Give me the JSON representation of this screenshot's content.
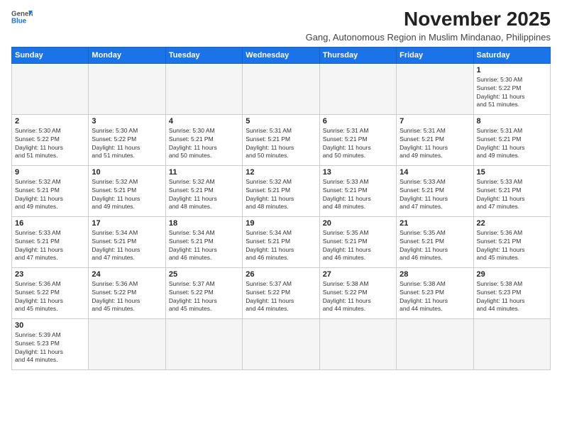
{
  "header": {
    "logo_general": "General",
    "logo_blue": "Blue",
    "month_title": "November 2025",
    "subtitle": "Gang, Autonomous Region in Muslim Mindanao, Philippines"
  },
  "weekdays": [
    "Sunday",
    "Monday",
    "Tuesday",
    "Wednesday",
    "Thursday",
    "Friday",
    "Saturday"
  ],
  "weeks": [
    [
      {
        "day": "",
        "info": ""
      },
      {
        "day": "",
        "info": ""
      },
      {
        "day": "",
        "info": ""
      },
      {
        "day": "",
        "info": ""
      },
      {
        "day": "",
        "info": ""
      },
      {
        "day": "",
        "info": ""
      },
      {
        "day": "1",
        "info": "Sunrise: 5:30 AM\nSunset: 5:22 PM\nDaylight: 11 hours\nand 51 minutes."
      }
    ],
    [
      {
        "day": "2",
        "info": "Sunrise: 5:30 AM\nSunset: 5:22 PM\nDaylight: 11 hours\nand 51 minutes."
      },
      {
        "day": "3",
        "info": "Sunrise: 5:30 AM\nSunset: 5:22 PM\nDaylight: 11 hours\nand 51 minutes."
      },
      {
        "day": "4",
        "info": "Sunrise: 5:30 AM\nSunset: 5:21 PM\nDaylight: 11 hours\nand 50 minutes."
      },
      {
        "day": "5",
        "info": "Sunrise: 5:31 AM\nSunset: 5:21 PM\nDaylight: 11 hours\nand 50 minutes."
      },
      {
        "day": "6",
        "info": "Sunrise: 5:31 AM\nSunset: 5:21 PM\nDaylight: 11 hours\nand 50 minutes."
      },
      {
        "day": "7",
        "info": "Sunrise: 5:31 AM\nSunset: 5:21 PM\nDaylight: 11 hours\nand 49 minutes."
      },
      {
        "day": "8",
        "info": "Sunrise: 5:31 AM\nSunset: 5:21 PM\nDaylight: 11 hours\nand 49 minutes."
      }
    ],
    [
      {
        "day": "9",
        "info": "Sunrise: 5:32 AM\nSunset: 5:21 PM\nDaylight: 11 hours\nand 49 minutes."
      },
      {
        "day": "10",
        "info": "Sunrise: 5:32 AM\nSunset: 5:21 PM\nDaylight: 11 hours\nand 49 minutes."
      },
      {
        "day": "11",
        "info": "Sunrise: 5:32 AM\nSunset: 5:21 PM\nDaylight: 11 hours\nand 48 minutes."
      },
      {
        "day": "12",
        "info": "Sunrise: 5:32 AM\nSunset: 5:21 PM\nDaylight: 11 hours\nand 48 minutes."
      },
      {
        "day": "13",
        "info": "Sunrise: 5:33 AM\nSunset: 5:21 PM\nDaylight: 11 hours\nand 48 minutes."
      },
      {
        "day": "14",
        "info": "Sunrise: 5:33 AM\nSunset: 5:21 PM\nDaylight: 11 hours\nand 47 minutes."
      },
      {
        "day": "15",
        "info": "Sunrise: 5:33 AM\nSunset: 5:21 PM\nDaylight: 11 hours\nand 47 minutes."
      }
    ],
    [
      {
        "day": "16",
        "info": "Sunrise: 5:33 AM\nSunset: 5:21 PM\nDaylight: 11 hours\nand 47 minutes."
      },
      {
        "day": "17",
        "info": "Sunrise: 5:34 AM\nSunset: 5:21 PM\nDaylight: 11 hours\nand 47 minutes."
      },
      {
        "day": "18",
        "info": "Sunrise: 5:34 AM\nSunset: 5:21 PM\nDaylight: 11 hours\nand 46 minutes."
      },
      {
        "day": "19",
        "info": "Sunrise: 5:34 AM\nSunset: 5:21 PM\nDaylight: 11 hours\nand 46 minutes."
      },
      {
        "day": "20",
        "info": "Sunrise: 5:35 AM\nSunset: 5:21 PM\nDaylight: 11 hours\nand 46 minutes."
      },
      {
        "day": "21",
        "info": "Sunrise: 5:35 AM\nSunset: 5:21 PM\nDaylight: 11 hours\nand 46 minutes."
      },
      {
        "day": "22",
        "info": "Sunrise: 5:36 AM\nSunset: 5:21 PM\nDaylight: 11 hours\nand 45 minutes."
      }
    ],
    [
      {
        "day": "23",
        "info": "Sunrise: 5:36 AM\nSunset: 5:22 PM\nDaylight: 11 hours\nand 45 minutes."
      },
      {
        "day": "24",
        "info": "Sunrise: 5:36 AM\nSunset: 5:22 PM\nDaylight: 11 hours\nand 45 minutes."
      },
      {
        "day": "25",
        "info": "Sunrise: 5:37 AM\nSunset: 5:22 PM\nDaylight: 11 hours\nand 45 minutes."
      },
      {
        "day": "26",
        "info": "Sunrise: 5:37 AM\nSunset: 5:22 PM\nDaylight: 11 hours\nand 44 minutes."
      },
      {
        "day": "27",
        "info": "Sunrise: 5:38 AM\nSunset: 5:22 PM\nDaylight: 11 hours\nand 44 minutes."
      },
      {
        "day": "28",
        "info": "Sunrise: 5:38 AM\nSunset: 5:23 PM\nDaylight: 11 hours\nand 44 minutes."
      },
      {
        "day": "29",
        "info": "Sunrise: 5:38 AM\nSunset: 5:23 PM\nDaylight: 11 hours\nand 44 minutes."
      }
    ],
    [
      {
        "day": "30",
        "info": "Sunrise: 5:39 AM\nSunset: 5:23 PM\nDaylight: 11 hours\nand 44 minutes."
      },
      {
        "day": "",
        "info": ""
      },
      {
        "day": "",
        "info": ""
      },
      {
        "day": "",
        "info": ""
      },
      {
        "day": "",
        "info": ""
      },
      {
        "day": "",
        "info": ""
      },
      {
        "day": "",
        "info": ""
      }
    ]
  ]
}
